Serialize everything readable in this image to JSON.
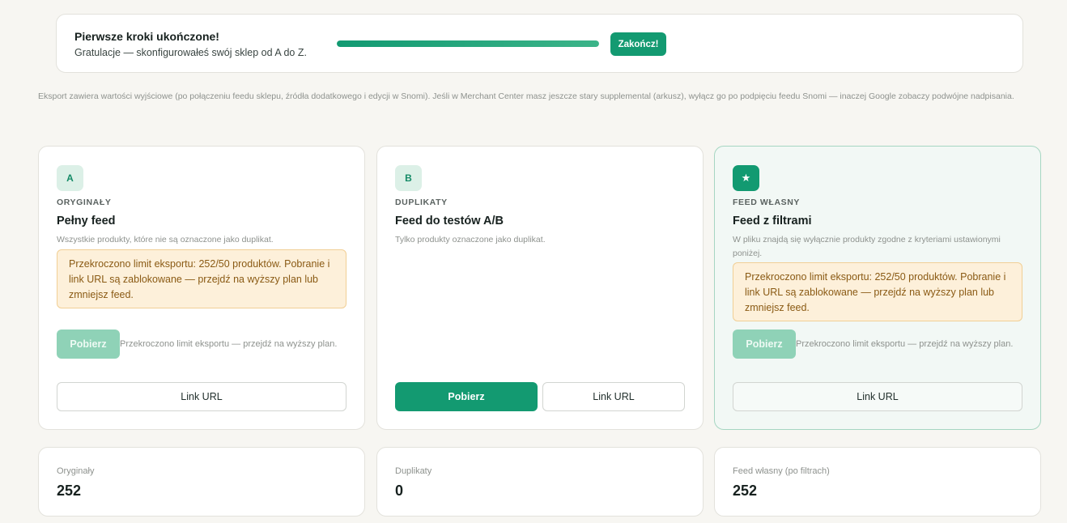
{
  "banner": {
    "title": "Pierwsze kroki ukończone!",
    "subtitle": "Gratulacje — skonfigurowałeś swój sklep od A do Z.",
    "progress_percent": 100,
    "finish_label": "Zakończ!"
  },
  "info_text": "Eksport zawiera wartości wyjściowe (po połączeniu feedu sklepu, źródła dodatkowego i edycji w Snomi). Jeśli w Merchant Center masz jeszcze stary supplemental (arkusz), wyłącz go po podpięciu feedu Snomi — inaczej Google zobaczy podwójne nadpisania.",
  "cards": [
    {
      "badge": "A",
      "kicker": "ORYGINAŁY",
      "title": "Pełny feed",
      "description": "Wszystkie produkty, które nie są oznaczone jako duplikat.",
      "alert": "Przekroczono limit eksportu: 252/50 produktów. Pobranie i link URL są zablokowane — przejdź na wyższy plan lub zmniejsz feed.",
      "download_label": "Pobierz",
      "limit_note": "Przekroczono limit eksportu — przejdź na wyższy plan.",
      "link_label": "Link URL"
    },
    {
      "badge": "B",
      "kicker": "DUPLIKATY",
      "title": "Feed do testów A/B",
      "description": "Tylko produkty oznaczone jako duplikat.",
      "download_label": "Pobierz",
      "link_label": "Link URL"
    },
    {
      "badge": "★",
      "kicker": "FEED WŁASNY",
      "title": "Feed z filtrami",
      "description": "W pliku znajdą się wyłącznie produkty zgodne z kryteriami ustawionymi poniżej.",
      "alert": "Przekroczono limit eksportu: 252/50 produktów. Pobranie i link URL są zablokowane — przejdź na wyższy plan lub zmniejsz feed.",
      "download_label": "Pobierz",
      "limit_note": "Przekroczono limit eksportu — przejdź na wyższy plan.",
      "link_label": "Link URL"
    }
  ],
  "stats": [
    {
      "label": "Oryginały",
      "value": "252"
    },
    {
      "label": "Duplikaty",
      "value": "0"
    },
    {
      "label": "Feed własny (po filtrach)",
      "value": "252"
    }
  ],
  "colors": {
    "accent": "#139a71",
    "accent_disabled": "#8fd2b7",
    "warning_bg": "#fdf0da",
    "warning_text": "#8a5a14",
    "page_bg": "#f7f6f2"
  }
}
